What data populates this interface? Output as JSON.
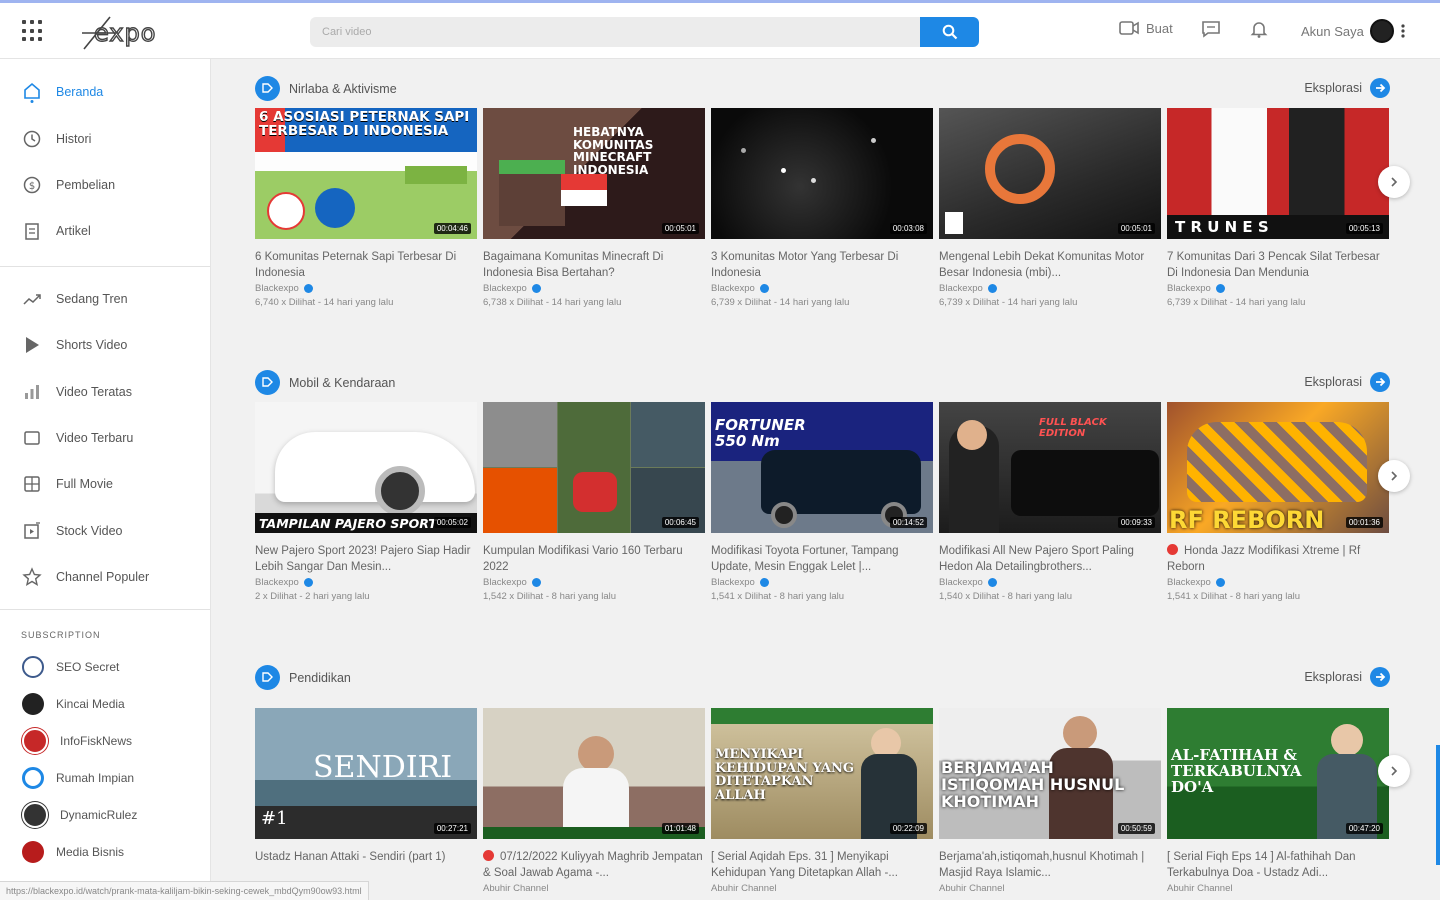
{
  "header": {
    "search_placeholder": "Cari video",
    "create_label": "Buat",
    "account_label": "Akun Saya"
  },
  "sidebar": {
    "nav_main": [
      {
        "label": "Beranda",
        "icon": "home-icon",
        "active": true
      },
      {
        "label": "Histori",
        "icon": "history-icon"
      },
      {
        "label": "Pembelian",
        "icon": "purchase-icon"
      },
      {
        "label": "Artikel",
        "icon": "article-icon"
      }
    ],
    "nav_explore": [
      {
        "label": "Sedang Tren",
        "icon": "trending-icon"
      },
      {
        "label": "Shorts Video",
        "icon": "shorts-icon"
      },
      {
        "label": "Video Teratas",
        "icon": "top-chart-icon"
      },
      {
        "label": "Video Terbaru",
        "icon": "new-video-icon"
      },
      {
        "label": "Full Movie",
        "icon": "movie-icon"
      },
      {
        "label": "Stock Video",
        "icon": "stock-video-icon"
      },
      {
        "label": "Channel Populer",
        "icon": "star-icon"
      }
    ],
    "subscription_heading": "SUBSCRIPTION",
    "subscriptions": [
      {
        "label": "SEO Secret",
        "color": "#3d5a8c"
      },
      {
        "label": "Kincai Media",
        "color": "#222222"
      },
      {
        "label": "InfoFiskNews",
        "color": "#c62828"
      },
      {
        "label": "Rumah Impian",
        "color": "#1e88e5"
      },
      {
        "label": "DynamicRulez",
        "color": "#333333"
      },
      {
        "label": "Media Bisnis",
        "color": "#b71c1c"
      }
    ]
  },
  "status_url": "https://blackexpo.id/watch/prank-mata-kaliljam-bikin-seking-cewek_mbdQym90ow93.html",
  "explore_label": "Eksplorasi",
  "sections": [
    {
      "title": "Nirlaba & Aktivisme",
      "videos": [
        {
          "title": "6 Komunitas Peternak Sapi Terbesar Di Indonesia",
          "channel": "Blackexpo",
          "stats": "6,740 x Dilihat - 14 hari yang lalu",
          "duration": "00:04:46",
          "thumb_text": "6 ASOSIASI PETERNAK SAPI TERBESAR DI INDONESIA"
        },
        {
          "title": "Bagaimana Komunitas Minecraft Di Indonesia Bisa Bertahan?",
          "channel": "Blackexpo",
          "stats": "6,738 x Dilihat - 14 hari yang lalu",
          "duration": "00:05:01",
          "thumb_text": "HEBATNYA KOMUNITAS MINECRAFT INDONESIA"
        },
        {
          "title": "3 Komunitas Motor Yang Terbesar Di Indonesia",
          "channel": "Blackexpo",
          "stats": "6,739 x Dilihat - 14 hari yang lalu",
          "duration": "00:03:08",
          "thumb_text": ""
        },
        {
          "title": "Mengenal Lebih Dekat Komunitas Motor Besar Indonesia (mbi)...",
          "channel": "Blackexpo",
          "stats": "6,739 x Dilihat - 14 hari yang lalu",
          "duration": "00:05:01",
          "thumb_text": ""
        },
        {
          "title": "7 Komunitas Dari 3 Pencak Silat Terbesar Di Indonesia Dan Mendunia",
          "channel": "Blackexpo",
          "stats": "6,739 x Dilihat - 14 hari yang lalu",
          "duration": "00:05:13",
          "thumb_text": "T R U N E S"
        }
      ]
    },
    {
      "title": "Mobil & Kendaraan",
      "videos": [
        {
          "title": "New Pajero Sport 2023! Pajero Siap Hadir Lebih Sangar Dan Mesin...",
          "channel": "Blackexpo",
          "stats": "2 x Dilihat - 2 hari yang lalu",
          "duration": "00:05:02",
          "thumb_text": "TAMPILAN PAJERO SPORT"
        },
        {
          "title": "Kumpulan Modifikasi Vario 160 Terbaru 2022",
          "channel": "Blackexpo",
          "stats": "1,542 x Dilihat - 8 hari yang lalu",
          "duration": "00:06:45",
          "thumb_text": ""
        },
        {
          "title": "Modifikasi Toyota Fortuner, Tampang Update, Mesin Enggak Lelet |...",
          "channel": "Blackexpo",
          "stats": "1,541 x Dilihat - 8 hari yang lalu",
          "duration": "00:14:52",
          "thumb_text": "FORTUNER 550 Nm"
        },
        {
          "title": "Modifikasi All New Pajero Sport Paling Hedon Ala Detailingbrothers...",
          "channel": "Blackexpo",
          "stats": "1,540 x Dilihat - 8 hari yang lalu",
          "duration": "00:09:33",
          "thumb_text": "FULL BLACK EDITION"
        },
        {
          "title": "Honda Jazz Modifikasi Xtreme | Rf Reborn",
          "channel": "Blackexpo",
          "stats": "1,541 x Dilihat - 8 hari yang lalu",
          "duration": "00:01:36",
          "thumb_text": "RF REBORN",
          "live": true
        }
      ]
    },
    {
      "title": "Pendidikan",
      "videos": [
        {
          "title": "Ustadz Hanan Attaki - Sendiri (part 1)",
          "channel": "",
          "stats": "",
          "duration": "00:27:21",
          "thumb_text": "SENDIRI"
        },
        {
          "title": "07/12/2022 Kuliyyah Maghrib Jempatan & Soal Jawab Agama -...",
          "channel": "Abuhir Channel",
          "stats": "",
          "duration": "01:01:48",
          "thumb_text": "",
          "live": true
        },
        {
          "title": "[ Serial Aqidah Eps. 31 ] Menyikapi Kehidupan Yang Ditetapkan Allah -...",
          "channel": "Abuhir Channel",
          "stats": "",
          "duration": "00:22:09",
          "thumb_text": "MENYIKAPI KEHIDUPAN YANG DITETAPKAN ALLAH"
        },
        {
          "title": "Berjama'ah,istiqomah,husnul Khotimah | Masjid Raya Islamic...",
          "channel": "Abuhir Channel",
          "stats": "",
          "duration": "00:50:59",
          "thumb_text": "BERJAMA'AH ISTIQOMAH HUSNUL KHOTIMAH"
        },
        {
          "title": "[ Serial Fiqh Eps 14 ] Al-fathihah Dan Terkabulnya Doa - Ustadz Adi...",
          "channel": "Abuhir Channel",
          "stats": "",
          "duration": "00:47:20",
          "thumb_text": "AL-FATIHAH & TERKABULNYA DO'A"
        }
      ]
    }
  ]
}
